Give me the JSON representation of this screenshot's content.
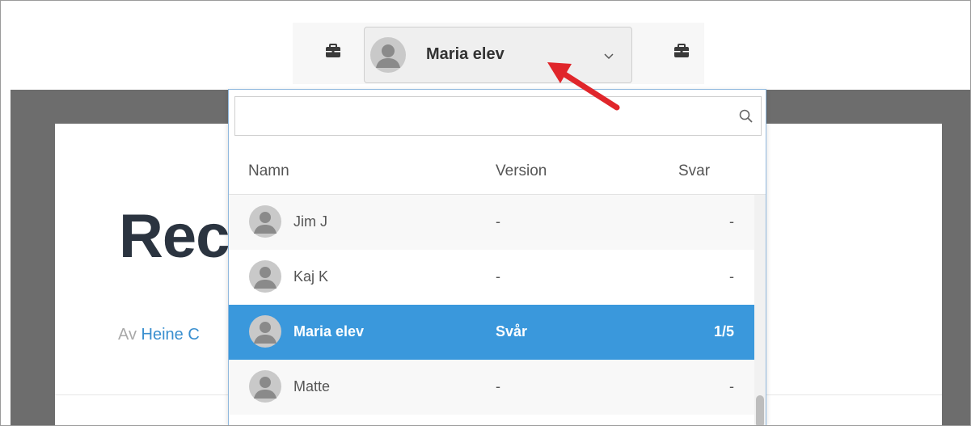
{
  "toolbar": {
    "left_icon": "briefcase-icon",
    "right_icon": "briefcase-icon",
    "selected_user": {
      "name": "Maria elev",
      "avatar_icon": "user-avatar-icon",
      "dropdown_icon": "chevron-down-icon"
    }
  },
  "page": {
    "title": "Rec",
    "byline_prefix": "Av",
    "author": "Heine C"
  },
  "dropdown": {
    "search": {
      "value": "",
      "placeholder": "",
      "icon": "search-icon"
    },
    "columns": {
      "name": "Namn",
      "version": "Version",
      "answer": "Svar"
    },
    "rows": [
      {
        "name": "Jim J",
        "version": "-",
        "answer": "-",
        "selected": false
      },
      {
        "name": "Kaj K",
        "version": "-",
        "answer": "-",
        "selected": false
      },
      {
        "name": "Maria elev",
        "version": "Svår",
        "answer": "1/5",
        "selected": true
      },
      {
        "name": "Matte",
        "version": "-",
        "answer": "-",
        "selected": false
      }
    ]
  },
  "colors": {
    "selected_row": "#3a98dc",
    "arrow": "#e0262b",
    "backdrop": "#6d6d6d",
    "title": "#2b3440",
    "link": "#3a8fcf"
  }
}
